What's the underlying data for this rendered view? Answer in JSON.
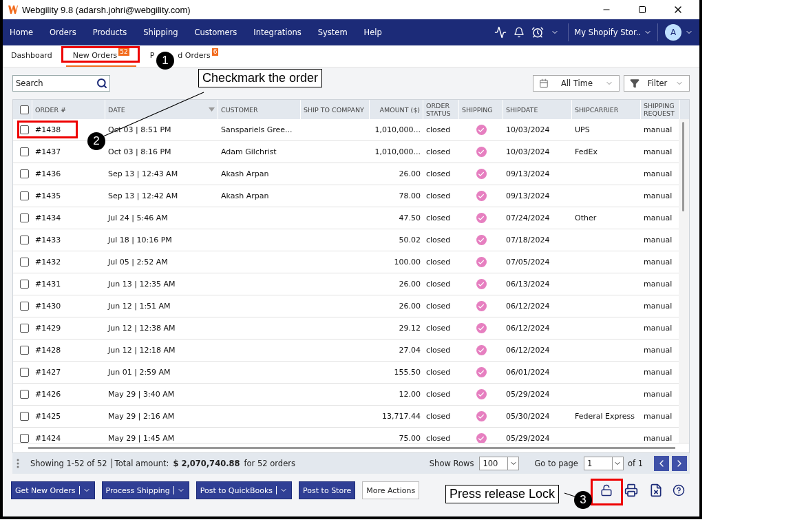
{
  "window": {
    "title": "Webgility 9.8 (adarsh.johri@webgility.com)"
  },
  "nav": {
    "items": [
      "Home",
      "Orders",
      "Products",
      "Shipping",
      "Customers",
      "Integrations",
      "System",
      "Help"
    ],
    "store": "My Shopify Stor..",
    "avatar": "A"
  },
  "tabs": [
    {
      "label_parts": [
        "Dashboard"
      ],
      "selected": false
    },
    {
      "label_parts": [
        "New Orders"
      ],
      "badge": "52",
      "selected": true
    },
    {
      "label_parts": [
        "P",
        "d Orders"
      ],
      "badge": "6",
      "selected": false
    }
  ],
  "search": {
    "placeholder": "Search"
  },
  "date_range": "All Time",
  "filter": "Filter",
  "table": {
    "all_checked": false,
    "columns": [
      {
        "label": "ORDER #",
        "sorted": false
      },
      {
        "label": "DATE",
        "sorted": true
      },
      {
        "label": "CUSTOMER",
        "sorted": false
      },
      {
        "label": "SHIP TO COMPANY",
        "sorted": false
      },
      {
        "label": "AMOUNT ($)",
        "sorted": false
      },
      {
        "label": "ORDER STATUS",
        "sorted": false
      },
      {
        "label": "SHIPPING",
        "sorted": false
      },
      {
        "label": "SHIPDATE",
        "sorted": false
      },
      {
        "label": "SHIPCARRIER",
        "sorted": false
      },
      {
        "label": "SHIPPING REQUEST",
        "sorted": false
      }
    ],
    "rows": [
      {
        "checked": false,
        "order": "#1438",
        "date": "Oct 03 | 8:51 PM",
        "customer": "Sanspariels Gree...",
        "company": "",
        "amount": "1,010,000...",
        "status": "closed",
        "shipped": true,
        "shipdate": "10/03/2024",
        "carrier": "UPS",
        "request": "manual"
      },
      {
        "checked": false,
        "order": "#1437",
        "date": "Oct 03 | 8:16 PM",
        "customer": "Adam Gilchrist",
        "company": "",
        "amount": "1,010,000...",
        "status": "closed",
        "shipped": true,
        "shipdate": "10/03/2024",
        "carrier": "FedEx",
        "request": "manual"
      },
      {
        "checked": false,
        "order": "#1436",
        "date": "Sep 13 | 12:43 AM",
        "customer": "Akash Arpan",
        "company": "",
        "amount": "26.00",
        "status": "closed",
        "shipped": true,
        "shipdate": "09/13/2024",
        "carrier": "",
        "request": "manual"
      },
      {
        "checked": false,
        "order": "#1435",
        "date": "Sep 13 | 12:42 AM",
        "customer": "Akash Arpan",
        "company": "",
        "amount": "78.00",
        "status": "closed",
        "shipped": true,
        "shipdate": "09/13/2024",
        "carrier": "",
        "request": "manual"
      },
      {
        "checked": false,
        "order": "#1434",
        "date": "Jul 24 | 5:46 AM",
        "customer": "",
        "company": "",
        "amount": "47.50",
        "status": "closed",
        "shipped": true,
        "shipdate": "07/24/2024",
        "carrier": "Other",
        "request": "manual"
      },
      {
        "checked": false,
        "order": "#1433",
        "date": "Jul 18 | 10:16 PM",
        "customer": "",
        "company": "",
        "amount": "50.02",
        "status": "closed",
        "shipped": true,
        "shipdate": "07/18/2024",
        "carrier": "",
        "request": "manual"
      },
      {
        "checked": false,
        "order": "#1432",
        "date": "Jul 05 | 2:52 AM",
        "customer": "",
        "company": "",
        "amount": "100.00",
        "status": "closed",
        "shipped": true,
        "shipdate": "07/05/2024",
        "carrier": "",
        "request": "manual"
      },
      {
        "checked": false,
        "order": "#1431",
        "date": "Jun 13 | 12:35 AM",
        "customer": "",
        "company": "",
        "amount": "26.00",
        "status": "closed",
        "shipped": true,
        "shipdate": "06/13/2024",
        "carrier": "",
        "request": "manual"
      },
      {
        "checked": false,
        "order": "#1430",
        "date": "Jun 12 | 1:51 AM",
        "customer": "",
        "company": "",
        "amount": "26.00",
        "status": "closed",
        "shipped": true,
        "shipdate": "06/12/2024",
        "carrier": "",
        "request": "manual"
      },
      {
        "checked": false,
        "order": "#1429",
        "date": "Jun 12 | 12:38 AM",
        "customer": "",
        "company": "",
        "amount": "29.12",
        "status": "closed",
        "shipped": true,
        "shipdate": "06/12/2024",
        "carrier": "",
        "request": "manual"
      },
      {
        "checked": false,
        "order": "#1428",
        "date": "Jun 12 | 12:18 AM",
        "customer": "",
        "company": "",
        "amount": "27.04",
        "status": "closed",
        "shipped": true,
        "shipdate": "06/12/2024",
        "carrier": "",
        "request": "manual"
      },
      {
        "checked": false,
        "order": "#1427",
        "date": "Jun 01 | 2:59 AM",
        "customer": "",
        "company": "",
        "amount": "155.50",
        "status": "closed",
        "shipped": true,
        "shipdate": "06/01/2024",
        "carrier": "",
        "request": "manual"
      },
      {
        "checked": false,
        "order": "#1426",
        "date": "May 29 | 3:40 AM",
        "customer": "",
        "company": "",
        "amount": "12.00",
        "status": "closed",
        "shipped": true,
        "shipdate": "05/29/2024",
        "carrier": "",
        "request": "manual"
      },
      {
        "checked": false,
        "order": "#1425",
        "date": "May 29 | 2:16 AM",
        "customer": "",
        "company": "",
        "amount": "13,717.44",
        "status": "closed",
        "shipped": true,
        "shipdate": "05/30/2024",
        "carrier": "Federal Express",
        "request": "manual"
      },
      {
        "checked": false,
        "order": "#1424",
        "date": "May 29 | 1:45 AM",
        "customer": "",
        "company": "",
        "amount": "75.00",
        "status": "closed",
        "shipped": true,
        "shipdate": "05/29/2024",
        "carrier": "",
        "request": "manual"
      }
    ]
  },
  "footer": {
    "showing": "Showing 1-52 of 52",
    "total_label": "Total amount:",
    "total_amount": "$ 2,070,740.88",
    "orders_text": "for 52 orders",
    "show_rows_label": "Show Rows",
    "rows_value": "100",
    "goto_label": "Go to page",
    "page_value": "1",
    "of_text": "of 1"
  },
  "actions": [
    {
      "label": "Get New Orders",
      "dropdown": true,
      "outline": false
    },
    {
      "label": "Process Shipping",
      "dropdown": true,
      "outline": false
    },
    {
      "label": "Post to QuickBooks",
      "dropdown": true,
      "outline": false
    },
    {
      "label": "Post to Store",
      "dropdown": false,
      "outline": false
    },
    {
      "label": "More Actions",
      "dropdown": false,
      "outline": true
    }
  ],
  "annotations": {
    "markers": [
      "1",
      "2",
      "3"
    ],
    "callouts": [
      "Checkmark the order",
      "Press release Lock"
    ]
  }
}
